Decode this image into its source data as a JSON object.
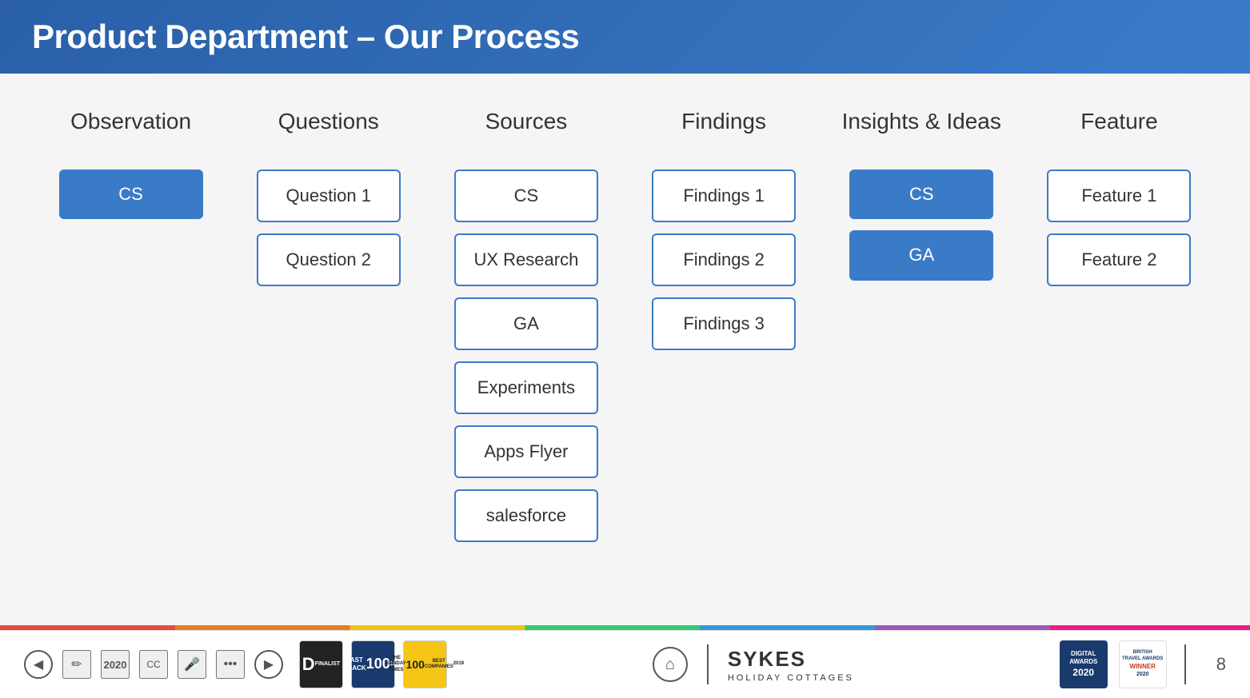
{
  "header": {
    "title": "Product Department – Our Process"
  },
  "columns": [
    {
      "id": "observation",
      "header": "Observation",
      "items": [
        {
          "label": "CS",
          "style": "filled"
        }
      ]
    },
    {
      "id": "questions",
      "header": "Questions",
      "items": [
        {
          "label": "Question 1",
          "style": "outline"
        },
        {
          "label": "Question 2",
          "style": "outline"
        }
      ]
    },
    {
      "id": "sources",
      "header": "Sources",
      "items": [
        {
          "label": "CS",
          "style": "outline"
        },
        {
          "label": "UX Research",
          "style": "outline"
        },
        {
          "label": "GA",
          "style": "outline"
        },
        {
          "label": "Experiments",
          "style": "outline"
        },
        {
          "label": "Apps Flyer",
          "style": "outline"
        },
        {
          "label": "salesforce",
          "style": "outline"
        }
      ]
    },
    {
      "id": "findings",
      "header": "Findings",
      "items": [
        {
          "label": "Findings 1",
          "style": "outline"
        },
        {
          "label": "Findings 2",
          "style": "outline"
        },
        {
          "label": "Findings 3",
          "style": "outline"
        }
      ]
    },
    {
      "id": "insights-ideas",
      "header": "Insights &\nIdeas",
      "items": [
        {
          "label": "CS",
          "style": "filled"
        },
        {
          "label": "GA",
          "style": "filled"
        }
      ]
    },
    {
      "id": "feature",
      "header": "Feature",
      "items": [
        {
          "label": "Feature 1",
          "style": "outline"
        },
        {
          "label": "Feature 2",
          "style": "outline"
        }
      ]
    }
  ],
  "footer": {
    "nav_prev": "◀",
    "nav_next": "▶",
    "edit_icon": "✏",
    "cc_icon": "CC",
    "mic_icon": "🎤",
    "more_icon": "•••",
    "badge1_line1": "D",
    "badge1_line2": "FINALIST",
    "badge2_line1": "FAST\nTRACK",
    "badge2_line2": "100",
    "badge3_line1": "THE SUNDAY TIMES",
    "badge3_line2": "100\nBEST COMPANIES\n2019",
    "logo_symbol": "⌂",
    "logo_text": "SYKES",
    "logo_subtext": "HOLIDAY COTTAGES",
    "award1_line1": "DIGITAL\nAWARDS",
    "award1_line2": "2020",
    "award2_line1": "BRITISH\nTRAVEL\nAWARDS",
    "award2_line2": "WINNER\n2020",
    "page_number": "8"
  }
}
